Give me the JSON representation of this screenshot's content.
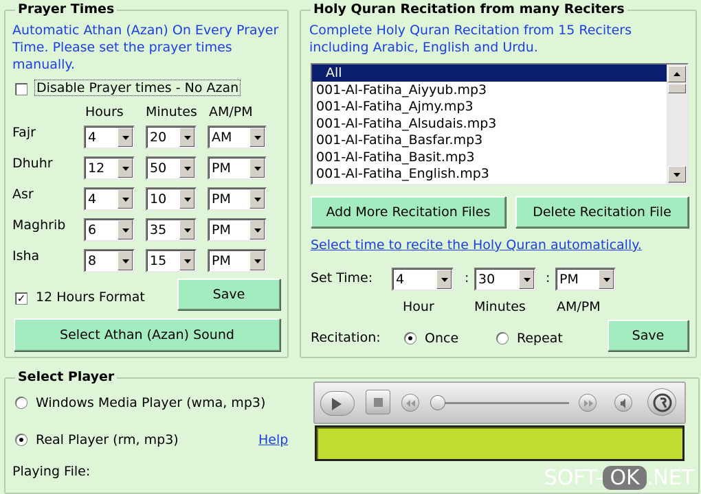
{
  "prayer": {
    "title": "Prayer Times",
    "description": "Automatic Athan (Azan) On Every Prayer Time. Please set the prayer times manually.",
    "disable_label": "Disable Prayer times - No Azan",
    "disable_checked": false,
    "col_hours": "Hours",
    "col_minutes": "Minutes",
    "col_ampm": "AM/PM",
    "rows": [
      {
        "name": "Fajr",
        "hour": "4",
        "minute": "20",
        "ampm": "AM"
      },
      {
        "name": "Dhuhr",
        "hour": "12",
        "minute": "50",
        "ampm": "PM"
      },
      {
        "name": "Asr",
        "hour": "4",
        "minute": "10",
        "ampm": "PM"
      },
      {
        "name": "Maghrib",
        "hour": "6",
        "minute": "35",
        "ampm": "PM"
      },
      {
        "name": "Isha",
        "hour": "8",
        "minute": "15",
        "ampm": "PM"
      }
    ],
    "format_label": "12 Hours Format",
    "format_checked": true,
    "format_check_glyph": "✓",
    "save_label": "Save",
    "athan_button": "Select Athan (Azan) Sound"
  },
  "quran": {
    "title": "Holy Quran Recitation from many Reciters",
    "description": "Complete Holy Quran Recitation from 15 Reciters including Arabic, English and Urdu.",
    "files": [
      "All",
      "001-Al-Fatiha_Aiyyub.mp3",
      "001-Al-Fatiha_Ajmy.mp3",
      "001-Al-Fatiha_Alsudais.mp3",
      "001-Al-Fatiha_Basfar.mp3",
      "001-Al-Fatiha_Basit.mp3",
      "001-Al-Fatiha_English.mp3"
    ],
    "add_button": "Add More Recitation Files",
    "delete_button": "Delete Recitation File",
    "auto_link": "Select time to recite the Holy Quran automatically.",
    "set_time_label": "Set Time:",
    "hour": "4",
    "minute": "30",
    "ampm": "PM",
    "separator": ":",
    "hour_caption": "Hour",
    "minutes_caption": "Minutes",
    "ampm_caption": "AM/PM",
    "recitation_label": "Recitation:",
    "once_label": "Once",
    "repeat_label": "Repeat",
    "mode": "once",
    "save_label": "Save"
  },
  "player": {
    "title": "Select Player",
    "wmp_label": "Windows Media Player (wma, mp3)",
    "real_label": "Real Player (rm, mp3)",
    "selected": "real",
    "help_link": "Help",
    "playing_label": "Playing File:"
  },
  "watermark": {
    "pre": "SOFT-",
    "ok": "OK",
    "post": ".NET"
  }
}
